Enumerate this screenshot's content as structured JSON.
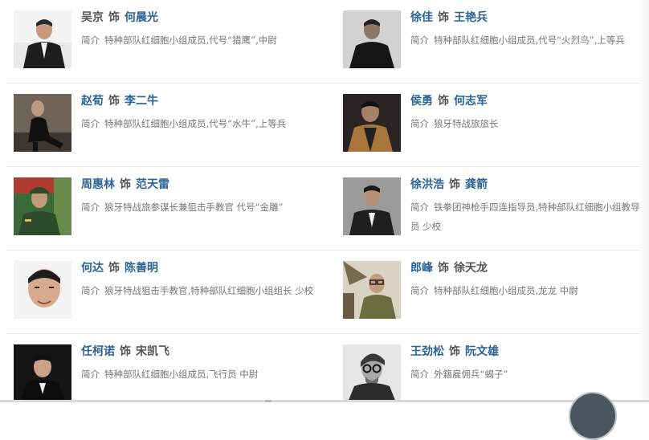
{
  "label_as": "饰",
  "label_intro": "简介",
  "cast": [
    {
      "actor": "吴京",
      "role": "何晨光",
      "intro": "特种部队红细胞小组成员,代号“猎鹰”,中尉"
    },
    {
      "actor": "徐佳",
      "role": "王艳兵",
      "intro": "特种部队红细胞小组成员,代号“火烈鸟”,上等兵"
    },
    {
      "actor": "赵荀",
      "role": "李二牛",
      "intro": "特种部队红细胞小组成员,代号“水牛”,上等兵"
    },
    {
      "actor": "侯勇",
      "role": "何志军",
      "intro": "狼牙特战旅旅长"
    },
    {
      "actor": "周惠林",
      "role": "范天雷",
      "intro": "狼牙特战旅参谋长兼狙击手教官 代号“金雕”"
    },
    {
      "actor": "徐洪浩",
      "role": "龚箭",
      "intro": "铁拳团神枪手四连指导员,特种部队红细胞小组教导员 少校"
    },
    {
      "actor": "何达",
      "role": "陈善明",
      "intro": "狼牙特战狙击手教官,特种部队红细胞小组组长 少校"
    },
    {
      "actor": "郎峰",
      "role": "徐天龙",
      "intro": "特种部队红细胞小组成员,龙龙 中尉"
    },
    {
      "actor": "任柯诺",
      "role": "宋凯飞",
      "intro": "特种部队红细胞小组成员,飞行员 中尉"
    },
    {
      "actor": "王劲松",
      "role": "阮文雄",
      "intro": "外籍雇佣兵“蝎子”"
    }
  ]
}
